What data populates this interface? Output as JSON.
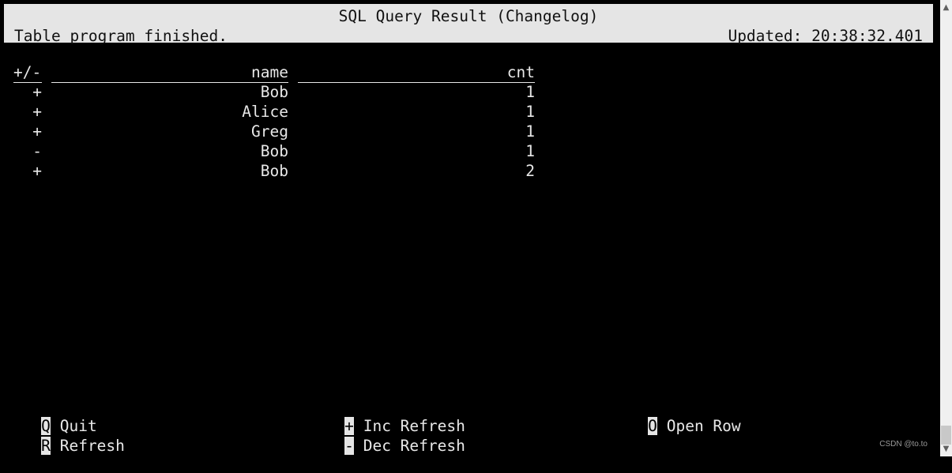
{
  "header": {
    "title": "SQL Query Result (Changelog)",
    "status": "Table program finished.",
    "updated": "Updated: 20:38:32.401"
  },
  "table": {
    "columns": [
      "+/-",
      "name",
      "cnt"
    ],
    "rows": [
      {
        "op": "+",
        "name": "Bob",
        "cnt": "1"
      },
      {
        "op": "+",
        "name": "Alice",
        "cnt": "1"
      },
      {
        "op": "+",
        "name": "Greg",
        "cnt": "1"
      },
      {
        "op": "-",
        "name": "Bob",
        "cnt": "1"
      },
      {
        "op": "+",
        "name": "Bob",
        "cnt": "2"
      }
    ]
  },
  "footer": {
    "keys": [
      {
        "key": "Q",
        "label": "Quit"
      },
      {
        "key": "R",
        "label": "Refresh"
      },
      {
        "key": "+",
        "label": "Inc Refresh"
      },
      {
        "key": "-",
        "label": "Dec Refresh"
      },
      {
        "key": "O",
        "label": "Open Row"
      }
    ]
  },
  "scrollbar": {
    "up_icon": "▲",
    "down_icon": "▼"
  },
  "watermark": "CSDN @to.to"
}
